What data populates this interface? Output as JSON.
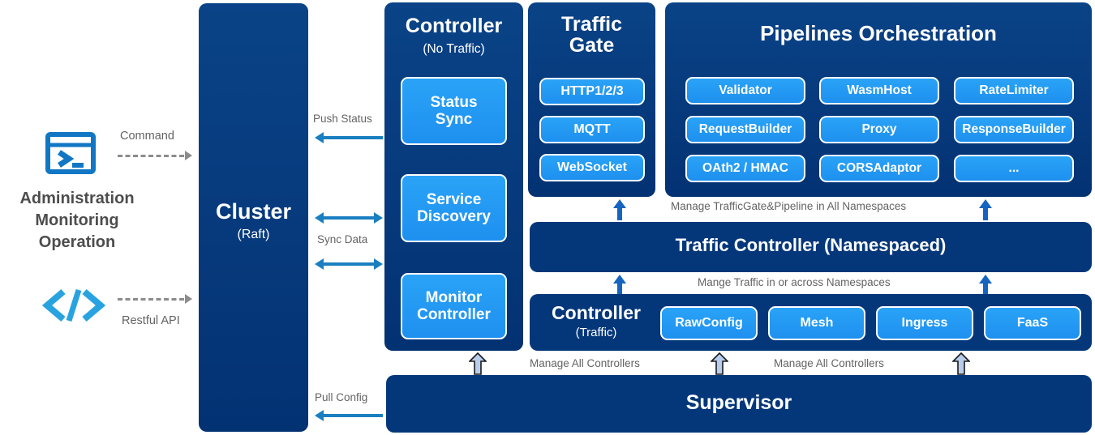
{
  "diagram": {
    "left_panel": {
      "terminal_icon": "terminal-icon",
      "code_icon": "code-brackets-icon",
      "caption": "Administration\nMonitoring\nOperation",
      "caption_lines": [
        "Administration",
        "Monitoring",
        "Operation"
      ],
      "command_label": "Command",
      "restful_label": "Restful API"
    },
    "cluster": {
      "title": "Cluster",
      "subtitle": "(Raft)"
    },
    "connectors": {
      "push_status": "Push Status",
      "sync_data": "Sync Data",
      "pull_config": "Pull Config",
      "manage_gate_pipeline": "Manage TrafficGate&Pipeline in All Namespaces",
      "manage_traffic": "Mange Traffic in or across Namespaces",
      "manage_all_controllers_1": "Manage All Controllers",
      "manage_all_controllers_2": "Manage All Controllers"
    },
    "controller_no_traffic": {
      "title": "Controller",
      "subtitle": "(No Traffic)",
      "items": [
        {
          "label": "Status\nSync",
          "lines": [
            "Status",
            "Sync"
          ]
        },
        {
          "label": "Service\nDiscovery",
          "lines": [
            "Service",
            "Discovery"
          ]
        },
        {
          "label": "Monitor\nController",
          "lines": [
            "Monitor",
            "Controller"
          ]
        }
      ]
    },
    "traffic_gate": {
      "title_lines": [
        "Traffic",
        "Gate"
      ],
      "items": [
        "HTTP1/2/3",
        "MQTT",
        "WebSocket"
      ]
    },
    "pipelines": {
      "title": "Pipelines Orchestration",
      "items": [
        "Validator",
        "WasmHost",
        "RateLimiter",
        "RequestBuilder",
        "Proxy",
        "ResponseBuilder",
        "OAth2 / HMAC",
        "CORSAdaptor",
        "..."
      ]
    },
    "traffic_controller": {
      "title": "Traffic Controller (Namespaced)"
    },
    "controller_traffic": {
      "title": "Controller",
      "subtitle": "(Traffic)",
      "items": [
        "RawConfig",
        "Mesh",
        "Ingress",
        "FaaS"
      ]
    },
    "supervisor": {
      "title": "Supervisor"
    },
    "colors": {
      "navy": "#063b7d",
      "navy_flat": "#04377a",
      "chip_blue": "#2aa3f7",
      "arrow_blue": "#1a7fc1",
      "up_arrow_blue": "#1565c0",
      "icon_blue": "#1177c4",
      "icon_cyan": "#29a3e0",
      "dash_gray": "#8c8c8c",
      "label_gray": "#636363",
      "caption_gray": "#4d4d4d",
      "block_arrow_fill": "#b8cdeb"
    }
  }
}
